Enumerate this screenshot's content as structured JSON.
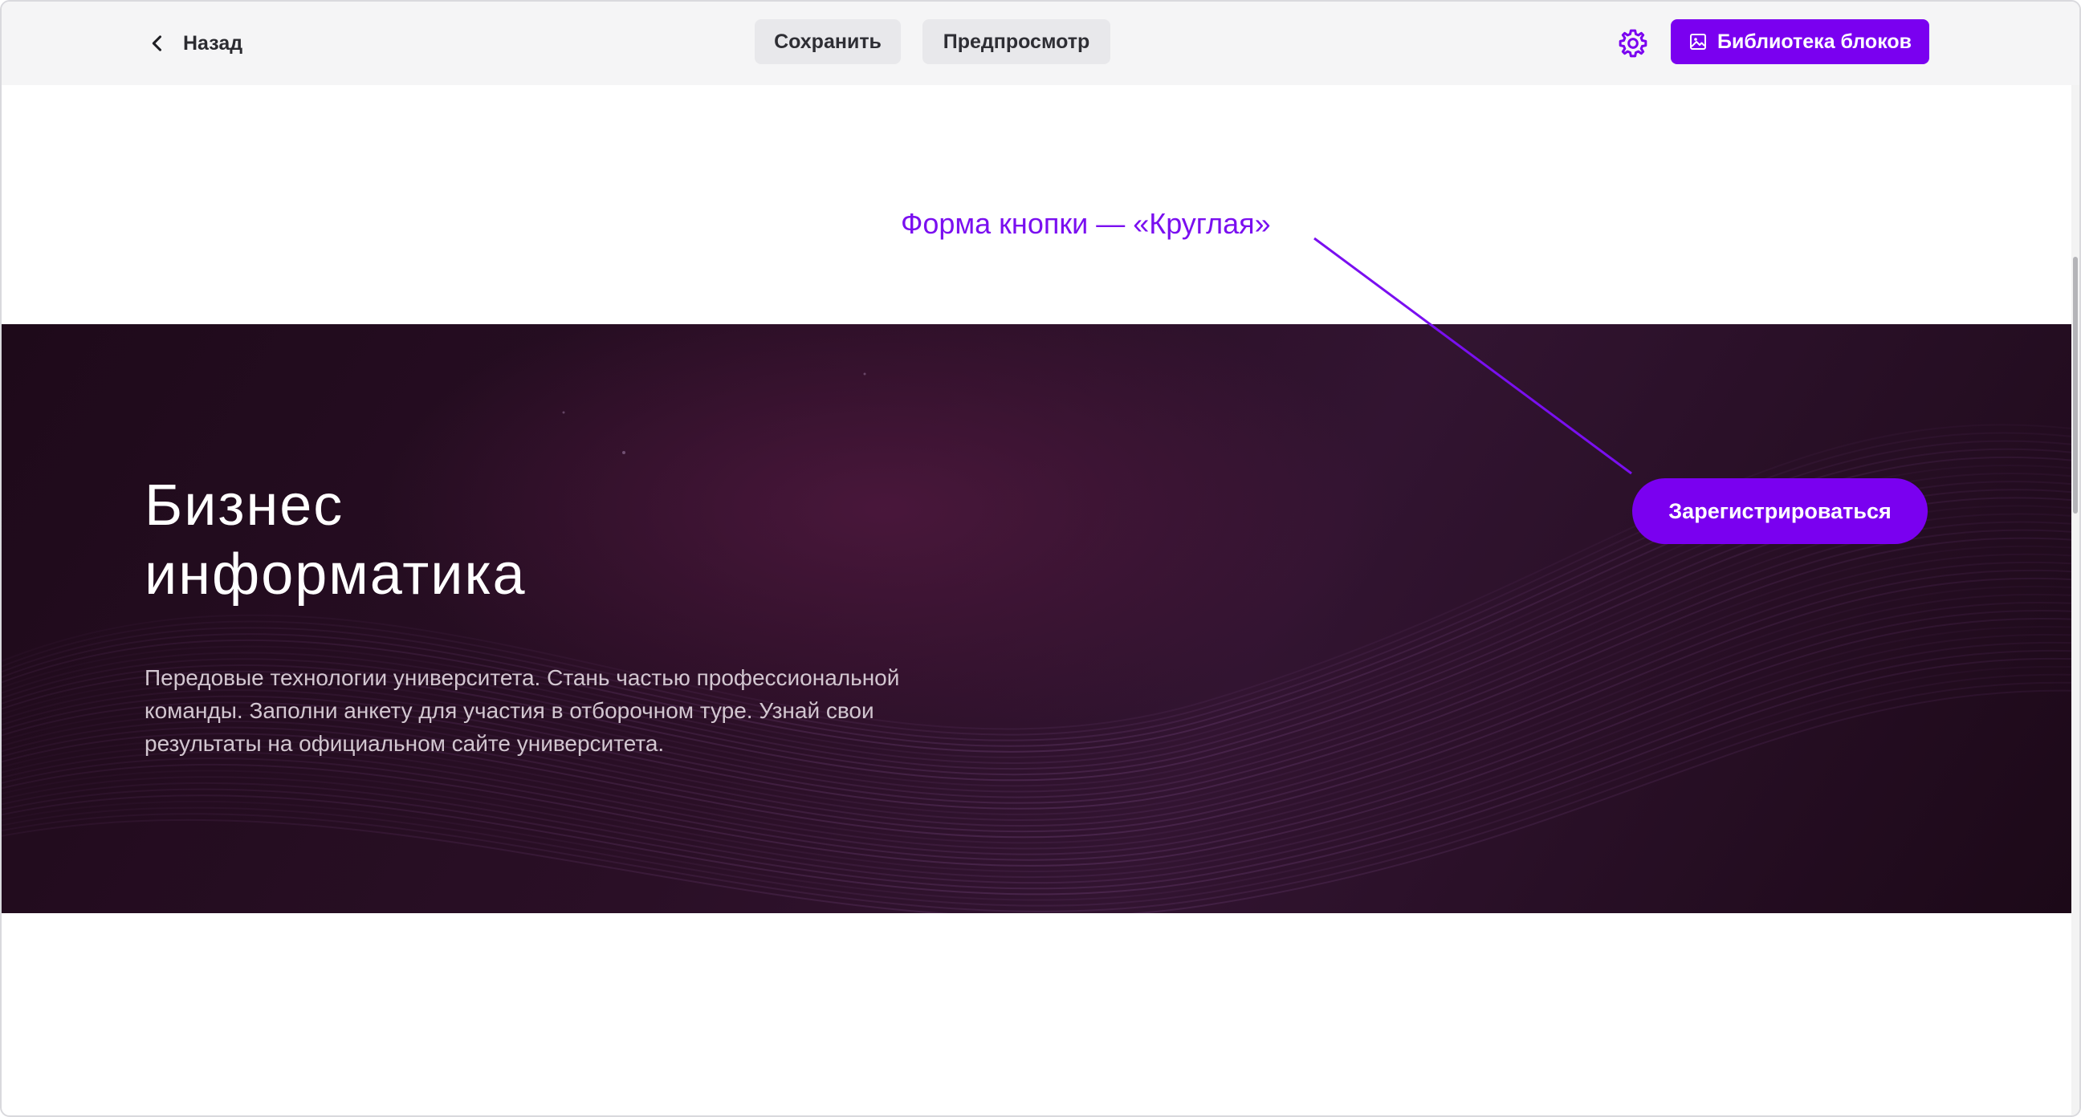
{
  "toolbar": {
    "back_label": "Назад",
    "save_label": "Сохранить",
    "preview_label": "Предпросмотр",
    "library_label": "Библиотека блоков",
    "icons": {
      "back": "chevron-left-icon",
      "settings": "gear-icon",
      "library": "image-icon"
    }
  },
  "annotation": {
    "text": "Форма кнопки — «Круглая»"
  },
  "hero": {
    "title_line1": "Бизнес",
    "title_line2": "информатика",
    "description": "Передовые технологии университета. Стань частью профессиональной команды. Заполни анкету для участия в отборочном туре. Узнай свои результаты на официальном сайте университета.",
    "cta_label": "Зарегистрироваться"
  },
  "colors": {
    "accent": "#7a00f0",
    "annotation": "#7a0ff0",
    "toolbar_bg": "#f5f5f6",
    "hero_bg": "#2a0f26"
  }
}
